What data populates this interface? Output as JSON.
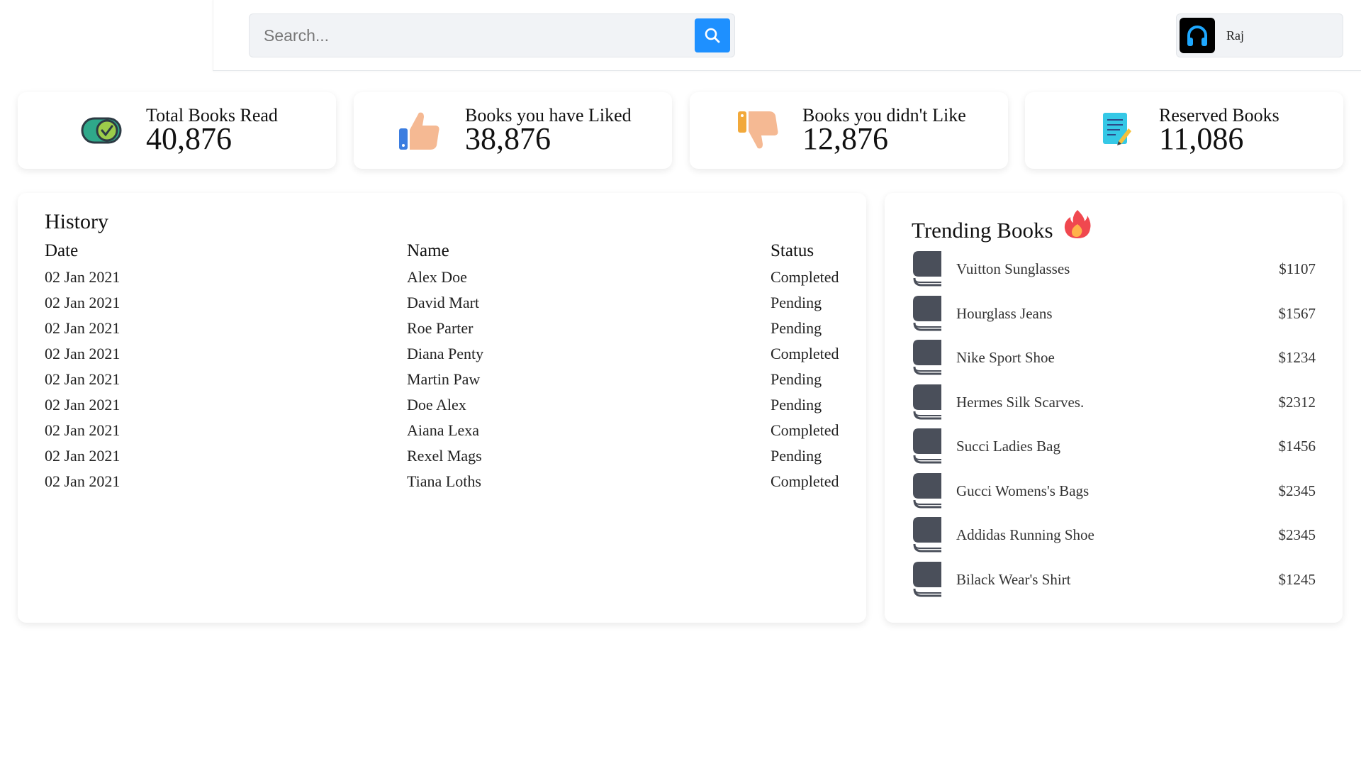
{
  "search": {
    "placeholder": "Search..."
  },
  "user": {
    "name": "Raj"
  },
  "stats": [
    {
      "label": "Total Books Read",
      "value": "40,876",
      "icon": "toggle-check-icon"
    },
    {
      "label": "Books you have Liked",
      "value": "38,876",
      "icon": "thumbs-up-icon"
    },
    {
      "label": "Books you didn't Like",
      "value": "12,876",
      "icon": "thumbs-down-icon"
    },
    {
      "label": "Reserved Books",
      "value": "11,086",
      "icon": "notepad-icon"
    }
  ],
  "history": {
    "title": "History",
    "columns": [
      "Date",
      "Name",
      "Status"
    ],
    "rows": [
      [
        "02 Jan 2021",
        "Alex Doe",
        "Completed"
      ],
      [
        "02 Jan 2021",
        "David Mart",
        "Pending"
      ],
      [
        "02 Jan 2021",
        "Roe Parter",
        "Pending"
      ],
      [
        "02 Jan 2021",
        "Diana Penty",
        "Completed"
      ],
      [
        "02 Jan 2021",
        "Martin Paw",
        "Pending"
      ],
      [
        "02 Jan 2021",
        "Doe Alex",
        "Pending"
      ],
      [
        "02 Jan 2021",
        "Aiana Lexa",
        "Completed"
      ],
      [
        "02 Jan 2021",
        "Rexel Mags",
        "Pending"
      ],
      [
        "02 Jan 2021",
        "Tiana Loths",
        "Completed"
      ]
    ]
  },
  "trending": {
    "title": "Trending Books",
    "items": [
      {
        "name": "Vuitton Sunglasses",
        "price": "$1107"
      },
      {
        "name": "Hourglass Jeans",
        "price": "$1567"
      },
      {
        "name": "Nike Sport Shoe",
        "price": "$1234"
      },
      {
        "name": "Hermes Silk Scarves.",
        "price": "$2312"
      },
      {
        "name": "Succi Ladies Bag",
        "price": "$1456"
      },
      {
        "name": "Gucci Womens's Bags",
        "price": "$2345"
      },
      {
        "name": "Addidas Running Shoe",
        "price": "$2345"
      },
      {
        "name": "Bilack Wear's Shirt",
        "price": "$1245"
      }
    ]
  },
  "colors": {
    "accent": "#1e90ff",
    "book_icon": "#4a4f5a",
    "fire": "#f0484f"
  }
}
